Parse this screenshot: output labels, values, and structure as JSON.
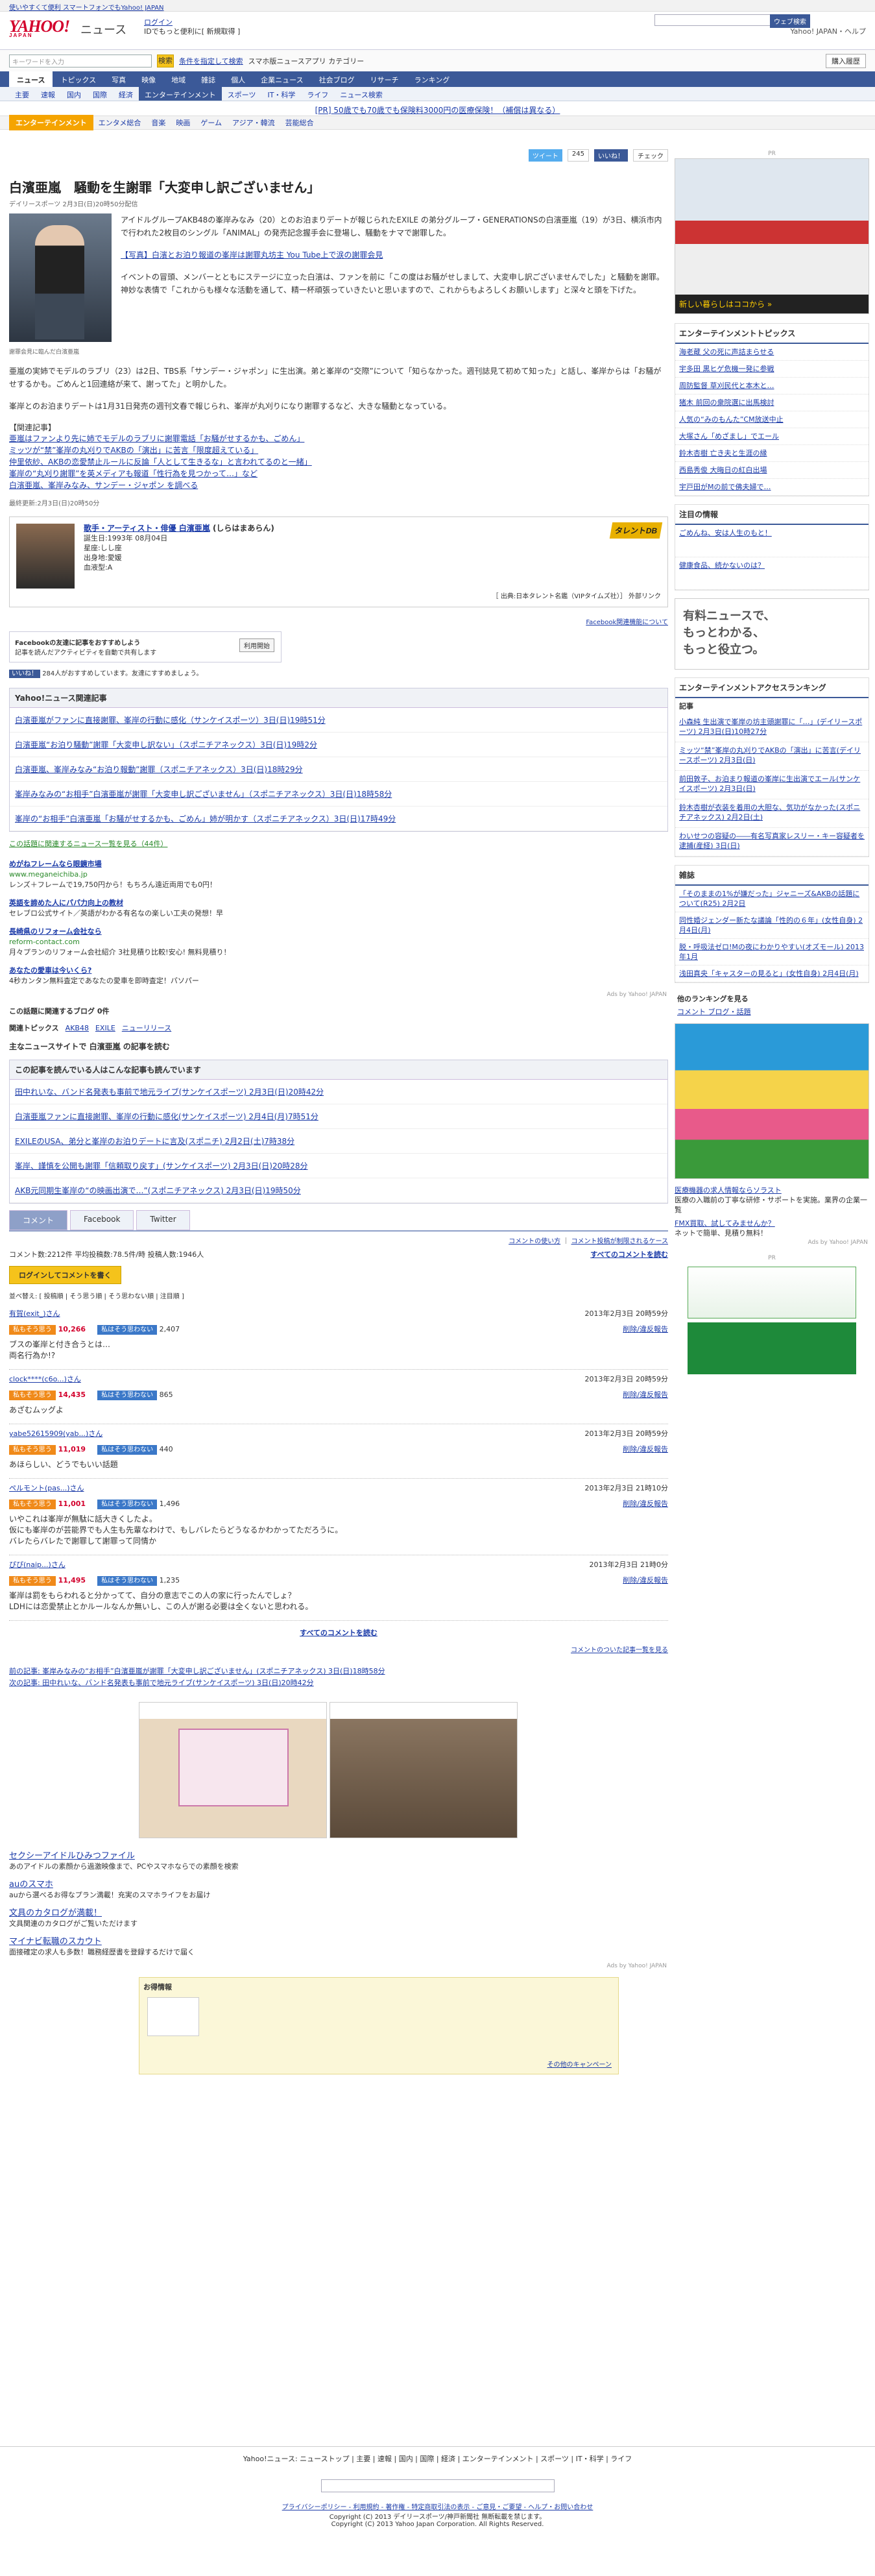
{
  "top_notice": "使いやすくて便利 スマートフォンでもYahoo! JAPAN",
  "header": {
    "logo": "YAHOO!",
    "logo_sub": "JAPAN",
    "section": "ニュース",
    "login": "ログイン",
    "login_sub": "IDでもっと便利に[ 新規取得 ]",
    "right_links": "Yahoo! JAPAN・ヘルプ"
  },
  "search": {
    "placeholder": "キーワードを入力",
    "button": "検索",
    "links": "条件を指定して検索",
    "app": "スマホ版ニュースアプリ カテゴリー",
    "subscribe": "購入履歴"
  },
  "nav_main": [
    "ニュース",
    "トピックス",
    "写真",
    "映像",
    "地域",
    "雑誌",
    "個人",
    "企業ニュース",
    "社会ブログ",
    "リサーチ",
    "ランキング"
  ],
  "nav_sub": [
    "主要",
    "速報",
    "国内",
    "国際",
    "経済",
    "エンターテインメント",
    "スポーツ",
    "IT・科学",
    "ライフ",
    "ニュース検索"
  ],
  "pr_text": "[PR] 50歳でも70歳でも保険料3000円の医療保険！（補償は異なる）",
  "subnav": {
    "label": "エンターテインメント",
    "items": [
      "エンタメ総合",
      "音楽",
      "映画",
      "ゲーム",
      "アジア・韓流",
      "芸能総合"
    ]
  },
  "share": {
    "tweet": "ツイート",
    "tweet_count": "245",
    "like": "いいね！",
    "check": "チェック"
  },
  "article": {
    "title": "白濱亜嵐　騒動を生謝罪「大変申し訳ございません」",
    "sub": "デイリースポーツ 2月3日(日)20時50分配信",
    "caption": "謝罪会見に臨んだ白濱亜嵐",
    "p1": "アイドルグループAKB48の峯岸みなみ（20）とのお泊まりデートが報じられたEXILE の弟分グループ・GENERATIONSの白濱亜嵐（19）が3日、横浜市内で行われた2枚目のシングル「ANIMAL」の発売記念握手会に登場し、騒動をナマで謝罪した。",
    "p2": "【写真】白濱とお泊り報道の峯岸は謝罪丸坊主 You Tube上で涙の謝罪会見",
    "p3": "イベントの冒頭、メンバーとともにステージに立った白濱は、ファンを前に「この度はお騒がせしまして、大変申し訳ございませんでした」と騒動を謝罪。神妙な表情で「これからも様々な活動を通して、精一杯頑張っていきたいと思いますので、これからもよろしくお願いします」と深々と頭を下げた。",
    "p4": "亜嵐の実姉でモデルのラブリ（23）は2日、TBS系「サンデー・ジャポン」に生出演。弟と峯岸の“交際”について「知らなかった。週刊誌見て初めて知った」と話し、峯岸からは「お騒がせするかも。ごめんと1回連絡が来て、謝ってた」と明かした。",
    "p5": "峯岸とのお泊まりデートは1月31日発売の週刊文春で報じられ、峯岸が丸刈りになり謝罪するなど、大きな騒動となっている。",
    "related_head": "【関連記事】",
    "related": [
      "亜嵐はファンより先に姉でモデルのラブリに謝罪電話「お騒がせするかも、ごめん」",
      "ミッツが“禁”峯岸の丸刈りでAKBの「演出」に苦言「限度超えている」",
      "仲里依紗、AKBの恋愛禁止ルールに反論「人として生きるな」と言われてるのと一緒」",
      "峯岸の“丸刈り謝罪”を英メディアも報道「性行為を見つかって…」など",
      "白濱亜嵐、峯岸みなみ、サンデー・ジャポン を調べる"
    ],
    "updated": "最終更新:2月3日(日)20時50分"
  },
  "profile": {
    "title": "歌手・アーティスト・俳優 白濱亜嵐",
    "kana": "(しらはまあらん)",
    "birth": "誕生日:1993年 08月04日",
    "zodiac": "星座:しし座",
    "place": "出身地:愛媛",
    "blood": "血液型:A",
    "source": "［ 出典:日本タレント名鑑（VIPタイムズ社）］ 外部リンク",
    "fb": "Facebook関連機能について",
    "fb_title": "Facebookの友達に記事をおすすめしよう",
    "fb_desc": "記事を読んだアクティビティを自動で共有します",
    "fb_btn": "利用開始",
    "like_count": "いいね！",
    "like_text": "284人がおすすめしています。友達にすすめましょう。"
  },
  "related_news": {
    "head": "Yahoo!ニュース関連記事",
    "items": [
      "白濱亜嵐がファンに直接謝罪、峯岸の行動に感化（サンケイスポーツ）3日(日)19時51分",
      "白濱亜嵐“お泊り騒動”謝罪「大変申し訳ない」（スポニチアネックス）3日(日)19時2分",
      "白濱亜嵐、峯岸みなみ“お泊り報動”謝罪（スポニチアネックス）3日(日)18時29分",
      "峯岸みなみの“お相手”白濱亜嵐が謝罪「大変申し訳ございません」（スポニチアネックス）3日(日)18時58分",
      "峯岸の“お相手”白濱亜嵐「お騒がせするかも、ごめん」姉が明かす（スポニチアネックス）3日(日)17時49分"
    ],
    "more": "この話題に関連するニュース一覧を見る（44件）"
  },
  "ads": [
    {
      "t": "めがねフレームなら眼鏡市場",
      "u": "www.meganeichiba.jp",
      "d": "レンズ＋フレームで19,750円から！もちろん遠近両用でも0円！"
    },
    {
      "t": "英語を諦めた人にパパ力向上の教材",
      "u": "",
      "d": "セレブロ公式サイト／英語がわかる有名なの楽しい工夫の発想！早"
    },
    {
      "t": "長崎県のリフォーム会社なら",
      "u": "reform-contact.com",
      "d": "月々プランのリフォーム会社紹介 3社見積り比較!安心! 無料見積り！"
    },
    {
      "t": "あなたの愛車は今いくら?",
      "u": "",
      "d": "4秒カンタン無料査定であなたの愛車を即時査定！パソパー"
    }
  ],
  "ads_label": "Ads by Yahoo! JAPAN",
  "blog_head": "この話題に関連するブログ 0件",
  "topics": {
    "head": "関連トピックス",
    "items": [
      "AKB48",
      "EXILE",
      "ニューリリース"
    ]
  },
  "mainsite": "主なニュースサイトで 白濱亜嵐 の記事を読む",
  "also_read": {
    "head": "この記事を読んでいる人はこんな記事も読んでいます",
    "items": [
      "田中れいな、バンド名発表も事前で地元ライブ(サンケイスポーツ) 2月3日(日)20時42分",
      "白濱亜嵐ファンに直接謝罪、峯岸の行動に感化(サンケイスポーツ) 2月4日(月)7時51分",
      "EXILEのUSA、弟分と峯岸のお泊りデートに言及(スポニチ) 2月2日(土)7時38分",
      "峯岸、謹慎を公開も謝罪「信頼取り戻す」(サンケイスポーツ) 2月3日(日)20時28分",
      "AKB元同期生峯岸の“の映画出演で…”(スポニチアネックス) 2月3日(日)19時50分"
    ]
  },
  "comments": {
    "tabs": [
      "コメント",
      "Facebook",
      "Twitter"
    ],
    "tab_sel": "コメント",
    "policy": "コメントの使い方",
    "report": "コメント投稿が制限されるケース",
    "stats": "コメント数:2212件 平均投稿数:78.5件/時 投稿人数:1946人",
    "all": "すべてのコメントを読む",
    "login": "ログインしてコメントを書く",
    "sort": "並べ替え: [ 投稿順 | そう思う順 | そう思わない順 | 注目順 ]",
    "list": [
      {
        "user": "有賀(exit_)さん",
        "date": "2013年2月3日 20時59分",
        "yes": "10,266",
        "no": "2,407",
        "text": "ブスの峯岸と付き合うとは…\n両名行為か!?"
      },
      {
        "user": "clock****(c6o...)さん",
        "date": "2013年2月3日 20時59分",
        "yes": "14,435",
        "no": "865",
        "text": "あざむムッグよ"
      },
      {
        "user": "yabe52615909(yab...)さん",
        "date": "2013年2月3日 20時59分",
        "yes": "11,019",
        "no": "440",
        "text": "あほらしい、どうでもいい話題"
      },
      {
        "user": "ペルモント(pas...)さん",
        "date": "2013年2月3日 21時10分",
        "yes": "11,001",
        "no": "1,496",
        "text": "いやこれは峯岸が無駄に話大きくしたよ。\n仮にも峯岸のが芸能界でも人生も先輩なわけで、もしバレたらどうなるかわかってただろうに。\nバレたらバレたで謝罪して謝罪って同情か"
      },
      {
        "user": "ぴぴ(naip...)さん",
        "date": "2013年2月3日 21時0分",
        "yes": "11,495",
        "no": "1,235",
        "text": "峯岸は罰をもらわれると分かってて、自分の意志でこの人の家に行ったんでしょ？\nLDHには恋愛禁止とかルールなんか無いし、この人が謝る必要は全くないと思われる。"
      }
    ],
    "vote_yes": "私もそう思う",
    "vote_no": "私はそう思わない",
    "report_link": "削除/違反報告",
    "more": "すべてのコメントを読む",
    "list_link": "コメントのついた記事一覧を見る"
  },
  "prev_next": {
    "prev": "前の記事: 峯岸みなみの“お相手”白濱亜嵐が謝罪「大変申し訳ございません」(スポニチアネックス) 3日(日)18時58分",
    "next": "次の記事: 田中れいな、バンド名発表も事前で地元ライブ(サンケイスポーツ) 3日(日)20時42分"
  },
  "bottom_ads": [
    {
      "t": "セクシーアイドルひみつファイル",
      "d": "あのアイドルの素顔から過激映像まで、PCやスマホならでの素顔を検索"
    },
    {
      "t": "auのスマホ",
      "d": "auから選べるお得なプラン満載！充実のスマホライフをお届け"
    },
    {
      "t": "文具のカタログが満載！",
      "d": "文具関連のカタログがご覧いただけます"
    },
    {
      "t": "マイナビ転職のスカウト",
      "d": "面接確定の求人も多数！職務経歴書を登録するだけで届く"
    }
  ],
  "deals": {
    "head": "お得情報",
    "text": "その他のキャンペーン"
  },
  "footer": {
    "links": "Yahoo!ニュース: ニューストップ | 主要 | 速報 | 国内 | 国際 | 経済 | エンターテインメント | スポーツ | IT・科学 | ライフ",
    "search_btn": "ウェブ検索",
    "legal": "プライバシーポリシー - 利用規約 - 著作権 - 特定商取引法の表示 - ご意見・ご要望 - ヘルプ・お問い合わせ",
    "copy1": "Copyright (C) 2013 デイリースポーツ/神戸新聞社 無断転載を禁じます。",
    "copy2": "Copyright (C) 2013 Yahoo Japan Corporation. All Rights Reserved."
  },
  "side": {
    "pr": "PR",
    "ranking_head": "エンターテインメントトピックス",
    "ranking": [
      "海老蔵 父の死に声詰まらせる",
      "宇多田 黒ヒゲ危機一発に参戦",
      "周防監督 草刈民代と本木と…",
      "猪木 前回の衆院選に出馬検討",
      "人気の“みのもんた”CM放送中止",
      "大塚さん「めざまし」でエール",
      "鈴木杏樹 亡き夫と生涯の縁",
      "西島秀俊 大晦日の紅白出場",
      "宇戸田がMの前で佛夫婦で…"
    ],
    "notice_head": "注目の情報",
    "notice": [
      "ごめんね、安は人生のもと！",
      "健康食品、続かないのは？"
    ],
    "access_head": "エンターテインメントアクセスランキング",
    "access_sub": "記事",
    "access": [
      "小森純 生出演で峯岸の坊主頭謝罪に「…」(デイリースポーツ) 2月3日(日)10時27分",
      "ミッツ“禁”峯岸の丸刈りでAKBの「演出」に苦言(デイリースポーツ) 2月3日(日)",
      "前田敦子、お泊まり報道の峯岸に生出演でエール(サンケイスポーツ) 2月3日(日)",
      "鈴木杏樹が衣装を着用の大胆な、気功がなかった(スポニチアネックス) 2月2日(土)",
      "わいせつの容疑の――有名写真家レスリー・キー容疑者を逮捕(産経) 3日(日)"
    ],
    "magazine_head": "雑誌",
    "magazine": [
      "「そのままの1%が嫌だった」ジャニーズ&AKBの話題について(R25) 2月2日",
      "同性婚ジェンダー新たな議論「性的の６年」(女性自身) 2月4日(月)",
      "脱・呼吸法ゼロ!Mの夜にわかりやすい(オズモール) 2013年1月",
      "浅田真央「キャスターの見ると」(女性自身) 2月4日(月)"
    ],
    "other_head": "他のランキングを見る",
    "other": "コメント ブログ・話題",
    "ad1_t": "医療機器の求人情報ならソラスト",
    "ad1_d": "医療の入職前の丁寧な研修・サポートを実施。業界の企業一覧",
    "ad2_t": "FMX買取、試してみませんか？",
    "ad2_d": "ネットで簡単、見積り無料！"
  }
}
